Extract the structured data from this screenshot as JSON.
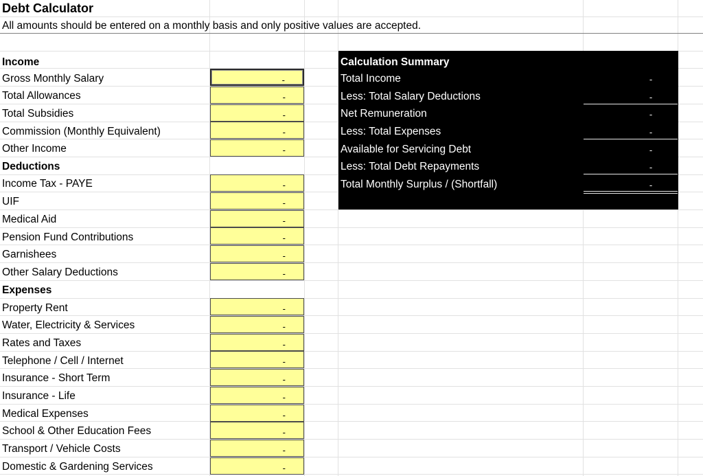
{
  "sheet": {
    "title": "Debt Calculator",
    "subtitle": "All amounts should be entered on a monthly basis and only positive values are accepted."
  },
  "income": {
    "header": "Income",
    "items": [
      {
        "label": "Gross Monthly Salary",
        "value": "-"
      },
      {
        "label": "Total Allowances",
        "value": "-"
      },
      {
        "label": "Total Subsidies",
        "value": "-"
      },
      {
        "label": "Commission (Monthly Equivalent)",
        "value": "-"
      },
      {
        "label": "Other Income",
        "value": "-"
      }
    ]
  },
  "deductions": {
    "header": "Deductions",
    "items": [
      {
        "label": "Income Tax - PAYE",
        "value": "-"
      },
      {
        "label": "UIF",
        "value": "-"
      },
      {
        "label": "Medical Aid",
        "value": "-"
      },
      {
        "label": "Pension Fund Contributions",
        "value": "-"
      },
      {
        "label": "Garnishees",
        "value": "-"
      },
      {
        "label": "Other Salary Deductions",
        "value": "-"
      }
    ]
  },
  "expenses": {
    "header": "Expenses",
    "items": [
      {
        "label": "Property Rent",
        "value": "-"
      },
      {
        "label": "Water, Electricity & Services",
        "value": "-"
      },
      {
        "label": "Rates and Taxes",
        "value": "-"
      },
      {
        "label": "Telephone / Cell / Internet",
        "value": "-"
      },
      {
        "label": "Insurance - Short Term",
        "value": "-"
      },
      {
        "label": "Insurance - Life",
        "value": "-"
      },
      {
        "label": "Medical Expenses",
        "value": "-"
      },
      {
        "label": "School & Other Education Fees",
        "value": "-"
      },
      {
        "label": "Transport / Vehicle Costs",
        "value": "-"
      },
      {
        "label": "Domestic & Gardening Services",
        "value": "-"
      }
    ]
  },
  "summary": {
    "header": "Calculation Summary",
    "rows": [
      {
        "label": "Total Income",
        "value": "-"
      },
      {
        "label": "Less: Total Salary Deductions",
        "value": "-"
      },
      {
        "label": "Net Remuneration",
        "value": "-"
      },
      {
        "label": "Less: Total Expenses",
        "value": "-"
      },
      {
        "label": "Available for Servicing Debt",
        "value": "-"
      },
      {
        "label": "Less: Total Debt Repayments",
        "value": "-"
      },
      {
        "label": "Total Monthly Surplus / (Shortfall)",
        "value": "-"
      }
    ]
  },
  "colors": {
    "input_fill": "#ffff99",
    "summary_background": "#000000",
    "summary_text": "#ffffff",
    "gridline": "#e1e1e1"
  }
}
